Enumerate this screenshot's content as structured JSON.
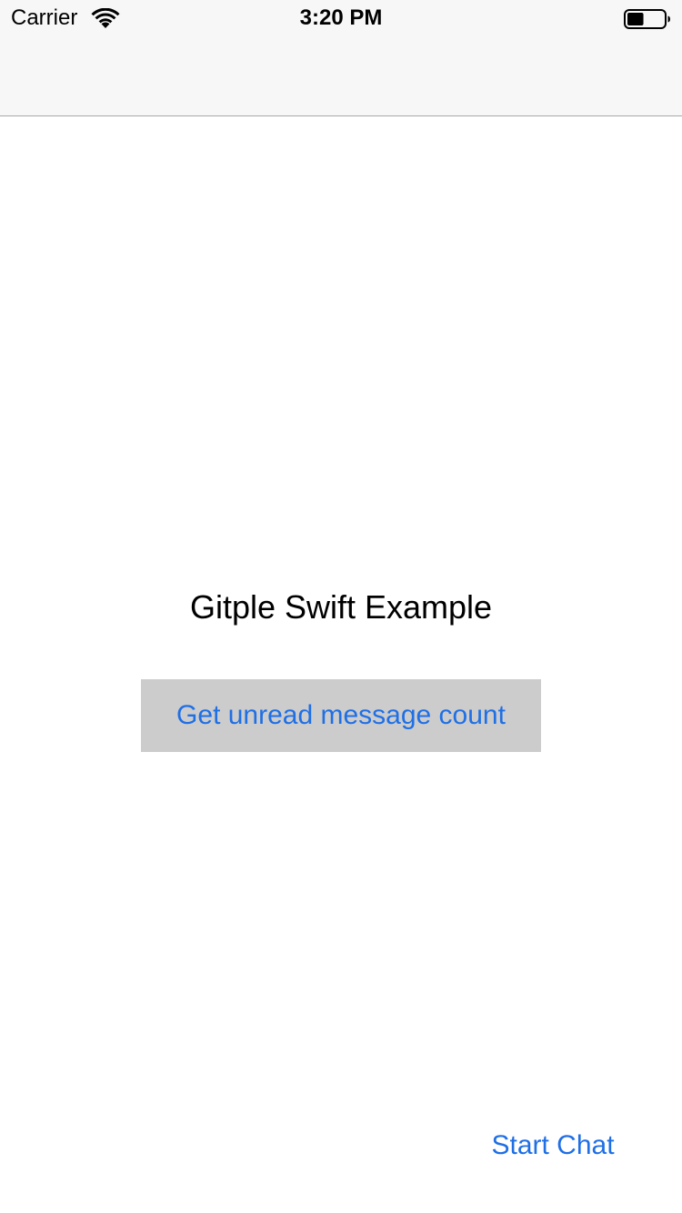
{
  "status_bar": {
    "carrier": "Carrier",
    "time": "3:20 PM",
    "wifi_icon": "wifi-icon",
    "battery_icon": "battery-icon",
    "battery_level": 0.45
  },
  "main": {
    "title": "Gitple Swift Example",
    "unread_button_label": "Get unread message count",
    "start_chat_label": "Start Chat"
  },
  "colors": {
    "accent": "#1f6fe5",
    "button_bg": "#cccccc",
    "nav_bg": "#f7f7f7",
    "nav_border": "#a8a8a8"
  }
}
